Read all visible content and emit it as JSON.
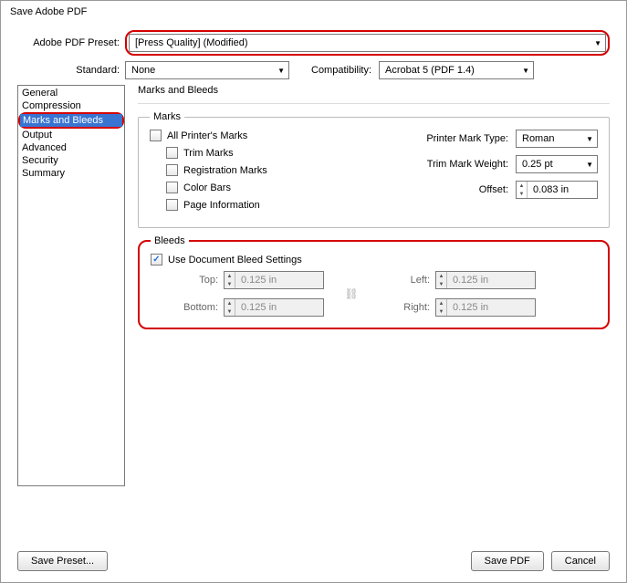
{
  "window": {
    "title": "Save Adobe PDF"
  },
  "preset": {
    "label": "Adobe PDF Preset:",
    "value": "[Press Quality] (Modified)"
  },
  "standard": {
    "label": "Standard:",
    "value": "None"
  },
  "compatibility": {
    "label": "Compatibility:",
    "value": "Acrobat 5 (PDF 1.4)"
  },
  "sidebar": {
    "items": [
      "General",
      "Compression",
      "Marks and Bleeds",
      "Output",
      "Advanced",
      "Security",
      "Summary"
    ],
    "selected_index": 2
  },
  "panel": {
    "title": "Marks and Bleeds",
    "marks": {
      "legend": "Marks",
      "all_printers_marks": "All Printer's Marks",
      "trim_marks": "Trim Marks",
      "registration_marks": "Registration Marks",
      "color_bars": "Color Bars",
      "page_information": "Page Information",
      "printer_mark_type": {
        "label": "Printer Mark Type:",
        "value": "Roman"
      },
      "trim_mark_weight": {
        "label": "Trim Mark Weight:",
        "value": "0.25 pt"
      },
      "offset": {
        "label": "Offset:",
        "value": "0.083 in"
      }
    },
    "bleeds": {
      "legend": "Bleeds",
      "use_document": "Use Document Bleed Settings",
      "use_document_checked": true,
      "top": {
        "label": "Top:",
        "value": "0.125 in"
      },
      "bottom": {
        "label": "Bottom:",
        "value": "0.125 in"
      },
      "left": {
        "label": "Left:",
        "value": "0.125 in"
      },
      "right": {
        "label": "Right:",
        "value": "0.125 in"
      }
    }
  },
  "buttons": {
    "save_preset": "Save Preset...",
    "save_pdf": "Save PDF",
    "cancel": "Cancel"
  }
}
